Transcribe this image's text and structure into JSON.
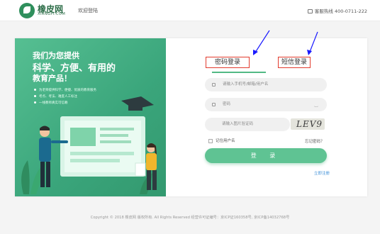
{
  "header": {
    "logo_cn": "橡皮网",
    "logo_en": "XIANGPI.COM",
    "welcome": "欢迎登陆",
    "hotline": "客服热线 400-0711-222"
  },
  "promo": {
    "line1": "我们为您提供",
    "line2": "科学、方便、有用的",
    "line3": "教育产品！",
    "bullets": [
      "为老师提供科学、便捷、优质的教育服务",
      "考点、考法、难度人工标注",
      "一线教师真实可信赖"
    ]
  },
  "login": {
    "tabs": [
      "密码登录",
      "短信登录"
    ],
    "account_placeholder": "请输入手机号/邮箱/用户名",
    "password_placeholder": "密码",
    "captcha_placeholder": "请输入图片验证码",
    "captcha_text": "LEV9",
    "remember_label": "记住用户名",
    "forgot_label": "忘记密码？",
    "submit_label": "登 录",
    "register_label": "立即注册"
  },
  "footer": {
    "text": "Copyright © 2018 橡皮网 版权所有. All Rights Reserved 经营许可证编号：京ICP证160358号, 京ICP备14032768号"
  },
  "colors": {
    "brand_green": "#52b985",
    "annotation_red": "#e23b2e",
    "annotation_blue": "#1a1aff",
    "link_blue": "#3d8fd8"
  }
}
